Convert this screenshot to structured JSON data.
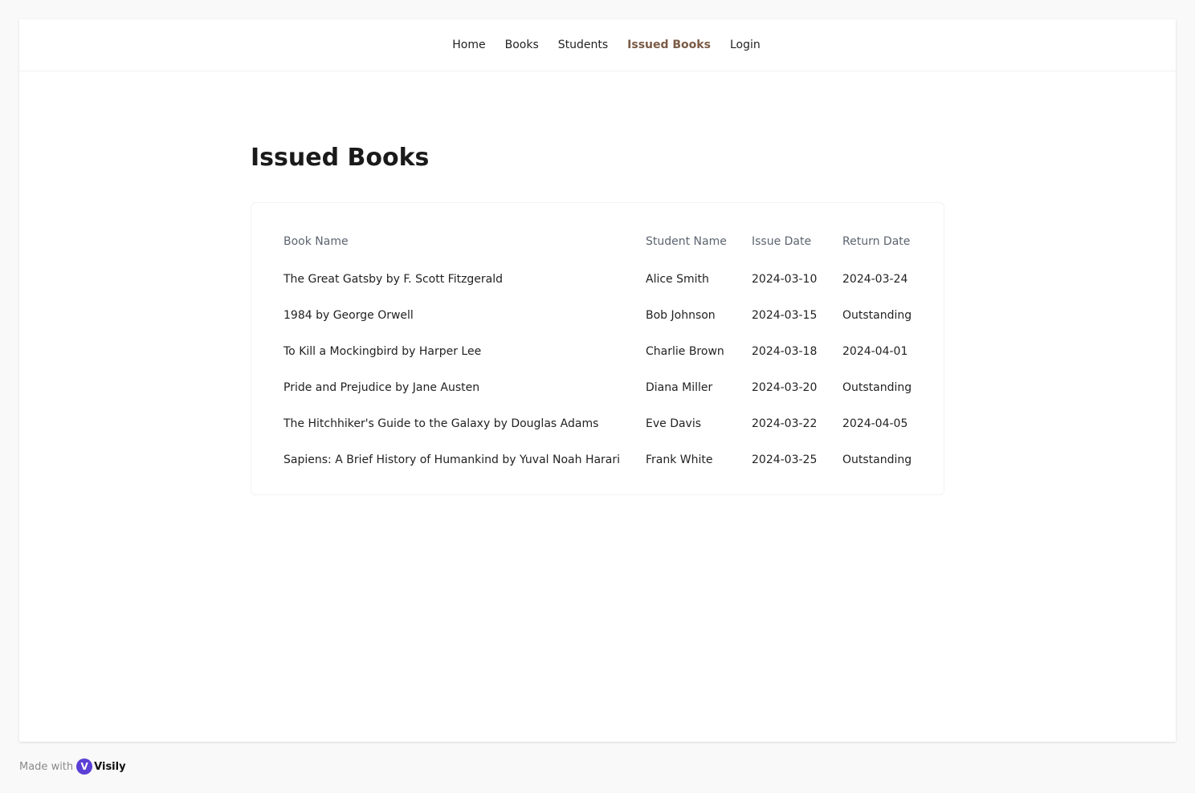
{
  "nav": {
    "items": [
      {
        "label": "Home"
      },
      {
        "label": "Books"
      },
      {
        "label": "Students"
      },
      {
        "label": "Issued Books"
      },
      {
        "label": "Login"
      }
    ],
    "active": "Issued Books"
  },
  "page": {
    "title": "Issued Books"
  },
  "table": {
    "headers": [
      "Book Name",
      "Student Name",
      "Issue Date",
      "Return Date"
    ],
    "rows": [
      [
        "The Great Gatsby by F. Scott Fitzgerald",
        "Alice Smith",
        "2024-03-10",
        "2024-03-24"
      ],
      [
        "1984 by George Orwell",
        "Bob Johnson",
        "2024-03-15",
        "Outstanding"
      ],
      [
        "To Kill a Mockingbird by Harper Lee",
        "Charlie Brown",
        "2024-03-18",
        "2024-04-01"
      ],
      [
        "Pride and Prejudice by Jane Austen",
        "Diana Miller",
        "2024-03-20",
        "Outstanding"
      ],
      [
        "The Hitchhiker's Guide to the Galaxy by Douglas Adams",
        "Eve Davis",
        "2024-03-22",
        "2024-04-05"
      ],
      [
        "Sapiens: A Brief History of Humankind by Yuval Noah Harari",
        "Frank White",
        "2024-03-25",
        "Outstanding"
      ]
    ]
  },
  "footer": {
    "made_with": "Made with",
    "brand": "Visily",
    "brand_icon": "visily-logo-icon"
  },
  "colors": {
    "active_nav": "#7a5a45",
    "brand": "#5b3fd6"
  }
}
